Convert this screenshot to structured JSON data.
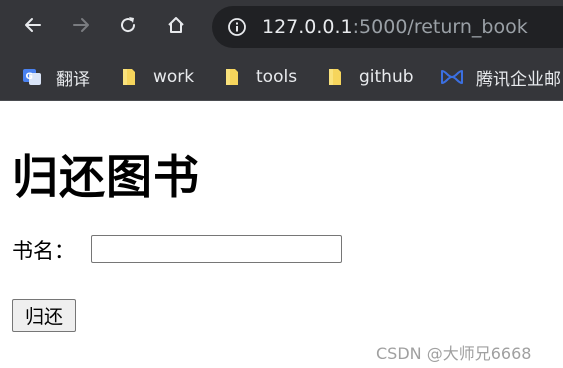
{
  "browser": {
    "url_host": "127.0.0.1",
    "url_rest": ":5000/return_book",
    "bookmarks": [
      {
        "label": "翻译",
        "icon": "translate-icon"
      },
      {
        "label": "work",
        "icon": "folder-icon"
      },
      {
        "label": "tools",
        "icon": "folder-icon"
      },
      {
        "label": "github",
        "icon": "folder-icon"
      },
      {
        "label": "腾讯企业邮",
        "icon": "tencent-mail-icon"
      }
    ],
    "colors": {
      "chrome_bg": "#35363a",
      "omnibox_bg": "#202124",
      "folder_yellow": "#f6d55c",
      "tencent_blue": "#3b6fe0",
      "translate_blue": "#4a82f0"
    }
  },
  "page": {
    "title": "归还图书",
    "form": {
      "book_name_label": "书名：",
      "book_name_value": "",
      "submit_label": "归还"
    },
    "watermark": "CSDN @大师兄6668"
  }
}
